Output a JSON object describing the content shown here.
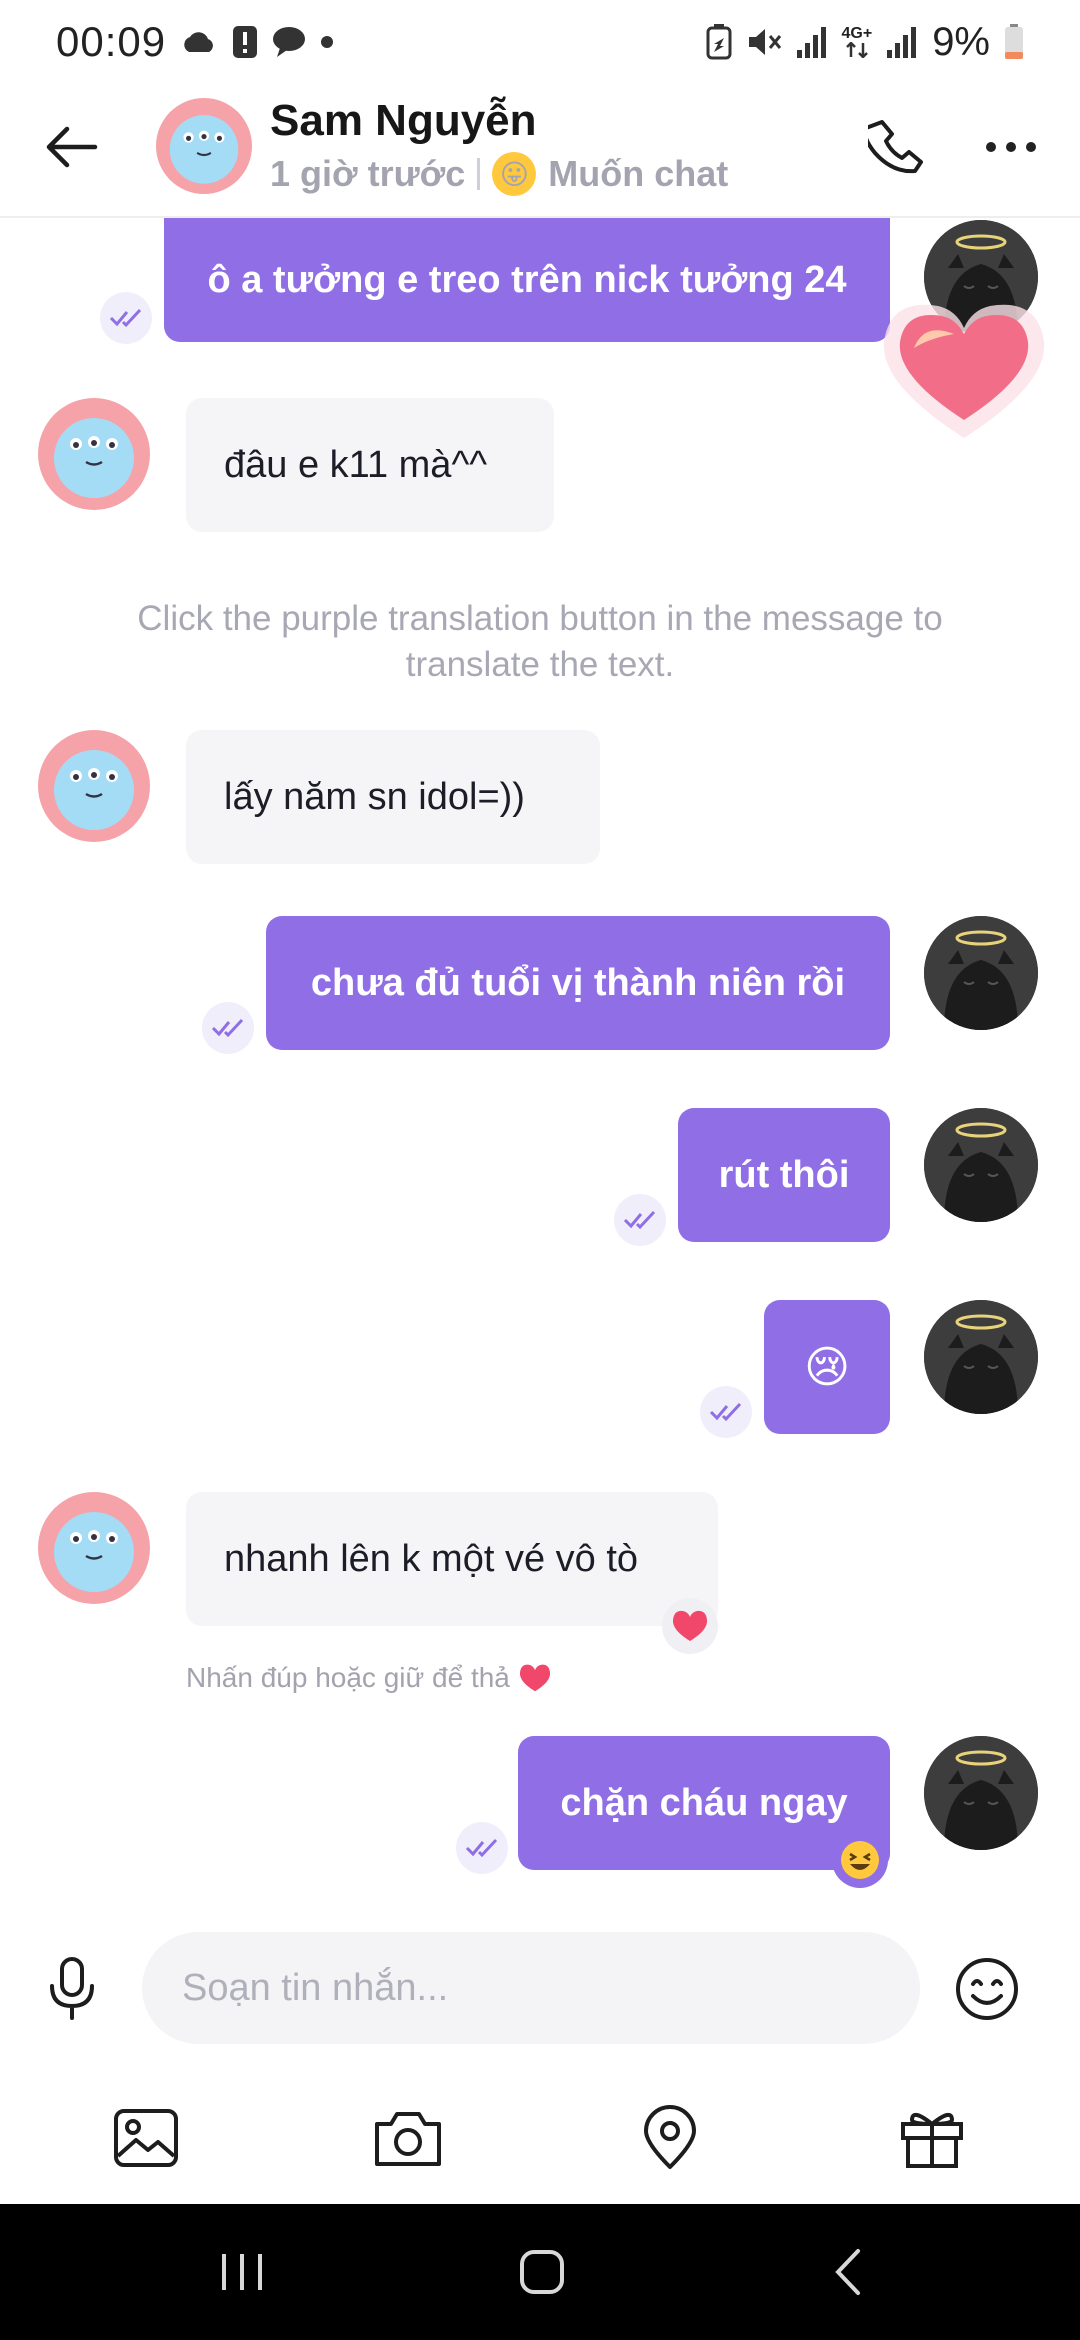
{
  "status_bar": {
    "time": "00:09",
    "battery": "9%",
    "network": "4G+"
  },
  "header": {
    "contact_name": "Sam Nguyễn",
    "last_seen": "1 giờ trước",
    "mood_label": "Muốn chat"
  },
  "messages": [
    {
      "direction": "outgoing",
      "text": "ô a tưởng e treo trên nick tưởng 24"
    },
    {
      "direction": "incoming",
      "text": "đâu e k11 mà^^"
    },
    {
      "direction": "incoming",
      "text": "lấy năm sn idol=))"
    },
    {
      "direction": "outgoing",
      "text": "chưa đủ tuổi vị thành niên rồi"
    },
    {
      "direction": "outgoing",
      "text": "rút thôi"
    },
    {
      "direction": "outgoing",
      "text": "😢",
      "emoji_only": true
    },
    {
      "direction": "incoming",
      "text": "nhanh lên k một vé vô tò",
      "reaction": "heart"
    },
    {
      "direction": "outgoing",
      "text": "chặn cháu ngay",
      "reaction": "laughing-face"
    }
  ],
  "system_notice": "Click the purple translation button in the message to translate the text.",
  "reaction_hint": "Nhấn đúp hoặc giữ để thả",
  "composer": {
    "placeholder": "Soạn tin nhắn..."
  },
  "colors": {
    "accent": "#8f6ee6",
    "incoming_bubble": "#f5f5f8",
    "heart": "#f0476b"
  },
  "icons": [
    "back-arrow-icon",
    "phone-icon",
    "more-icon",
    "microphone-icon",
    "smiley-icon",
    "image-icon",
    "camera-icon",
    "location-icon",
    "gift-icon"
  ]
}
